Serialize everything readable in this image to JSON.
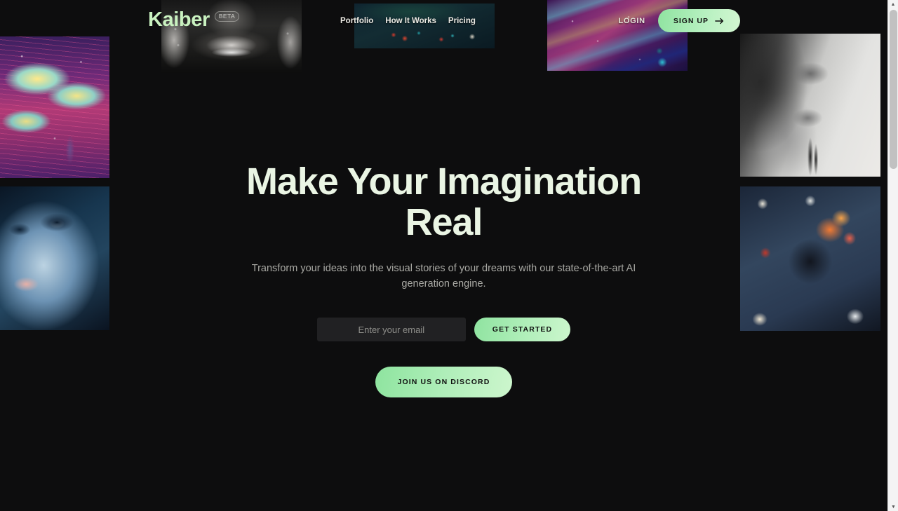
{
  "site": {
    "logo_text": "Kaiber",
    "beta_badge": "BETA"
  },
  "nav": {
    "links": [
      {
        "label": "Portfolio"
      },
      {
        "label": "How It Works"
      },
      {
        "label": "Pricing"
      }
    ],
    "login_label": "LOGIN",
    "signup_label": "SIGN UP",
    "signup_icon": "arrow-right-icon"
  },
  "hero": {
    "title": "Make Your Imagination Real",
    "subtitle": "Transform your ideas into the visual stories of your dreams with our state-of-the-art AI generation engine.",
    "email_placeholder": "Enter your email",
    "email_value": "",
    "get_started_label": "GET STARTED",
    "discord_label": "JOIN US ON DISCORD"
  },
  "gallery": {
    "top_left": "monochrome-portrait-with-earrings",
    "nav_backdrop": "abstract-teal-red-artwork",
    "top_right": "cosmic-purple-waves-figure",
    "left_upper": "psychedelic-cloudscape-figure",
    "left_lower": "blue-lit-female-portrait",
    "right_upper": "monochrome-smoke-foxes",
    "right_lower": "abstract-cosmic-splatter"
  },
  "colors": {
    "background": "#0d0d0e",
    "accent_green": "#a8ecb4",
    "logo_green": "#c9f2c0",
    "heading": "#eaf5e4",
    "body_text": "#a9a9a4",
    "input_bg": "#212123"
  },
  "browser": {
    "scroll_up_icon": "▲",
    "scroll_down_icon": "▼"
  }
}
